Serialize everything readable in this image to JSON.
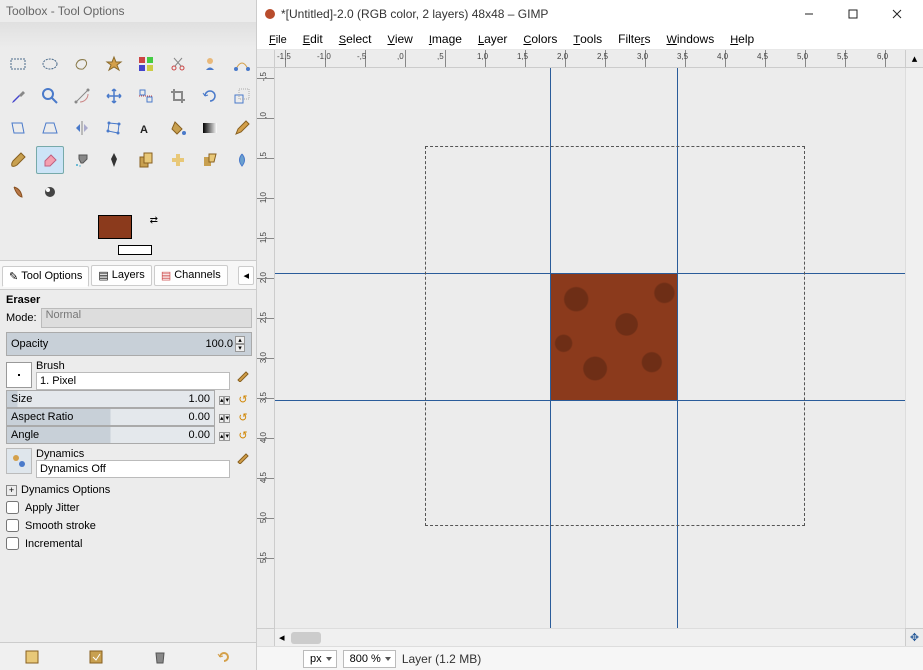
{
  "toolbox": {
    "title": "Toolbox - Tool Options",
    "tools": [
      "rect-select",
      "ellipse-select",
      "free-select",
      "fuzzy-select",
      "by-color-select",
      "scissors",
      "foreground-select",
      "paths",
      "color-picker",
      "zoom",
      "measure",
      "move",
      "align",
      "crop",
      "rotate",
      "scale",
      "shear",
      "perspective",
      "flip",
      "text",
      "bucket-fill",
      "blend",
      "pencil",
      "paintbrush",
      "brush",
      "eraser",
      "airbrush",
      "ink",
      "clone",
      "heal",
      "perspective-clone",
      "blur",
      "smudge",
      "dodge"
    ],
    "fg_color": "#8b3a1c",
    "tabs": {
      "tool_options": "Tool Options",
      "layers": "Layers",
      "channels": "Channels"
    },
    "eraser": {
      "title": "Eraser",
      "mode_label": "Mode:",
      "mode_value": "Normal",
      "opacity_label": "Opacity",
      "opacity_value": "100.0",
      "brush_label": "Brush",
      "brush_name": "1. Pixel",
      "size_label": "Size",
      "size_value": "1.00",
      "aspect_label": "Aspect Ratio",
      "aspect_value": "0.00",
      "angle_label": "Angle",
      "angle_value": "0.00",
      "dynamics_label": "Dynamics",
      "dynamics_value": "Dynamics Off",
      "dynamics_options": "Dynamics Options",
      "apply_jitter": "Apply Jitter",
      "smooth_stroke": "Smooth stroke",
      "incremental": "Incremental"
    }
  },
  "window": {
    "title": "*[Untitled]-2.0 (RGB color, 2 layers) 48x48 – GIMP",
    "menus": [
      "File",
      "Edit",
      "Select",
      "View",
      "Image",
      "Layer",
      "Colors",
      "Tools",
      "Filters",
      "Windows",
      "Help"
    ],
    "ruler_h": [
      "-1,5",
      "-1,0",
      "-,5",
      ",0",
      ",5",
      "1,0",
      "1,5",
      "2,0",
      "2,5",
      "3,0",
      "3,5",
      "4,0",
      "4,5",
      "5,0",
      "5,5",
      "6,0"
    ],
    "ruler_v": [
      "-,5",
      ",0",
      ",5",
      "1,0",
      "1,5",
      "2,0",
      "2,5",
      "3,0",
      "3,5",
      "4,0",
      "4,5",
      "5,0",
      "5,5"
    ],
    "status": {
      "units": "px",
      "zoom": "800 %",
      "layer": "Layer (1.2 MB)"
    }
  }
}
